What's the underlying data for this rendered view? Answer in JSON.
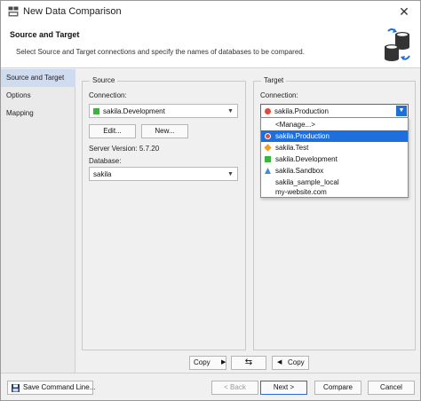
{
  "window": {
    "title": "New Data Comparison",
    "close_glyph": "✕"
  },
  "header": {
    "title": "Source and Target",
    "description": "Select Source and Target connections and specify the names of databases to be compared.",
    "icon": "database-compare-icon"
  },
  "nav": {
    "items": [
      {
        "label": "Source and Target",
        "active": true
      },
      {
        "label": "Options",
        "active": false
      },
      {
        "label": "Mapping",
        "active": false
      }
    ]
  },
  "source": {
    "legend": "Source",
    "connection_label": "Connection:",
    "connection_value": "sakila.Development",
    "connection_color": "#3cb43c",
    "edit_button": "Edit...",
    "new_button": "New...",
    "server_version": "Server Version: 5.7.20",
    "database_label": "Database:",
    "database_value": "sakila"
  },
  "target": {
    "legend": "Target",
    "connection_label": "Connection:",
    "connection_value": "sakila.Production",
    "connection_color": "#e04a3a",
    "dropdown_items": [
      {
        "label": "<Manage...>",
        "icon": "none",
        "color": ""
      },
      {
        "label": "sakila.Production",
        "icon": "circle",
        "color": "#e04a3a",
        "selected": true
      },
      {
        "label": "sakila.Test",
        "icon": "diamond",
        "color": "#f2a01c"
      },
      {
        "label": "sakila.Development",
        "icon": "square",
        "color": "#3cb43c"
      },
      {
        "label": "sakila.Sandbox",
        "icon": "triangle",
        "color": "#3a8ee0"
      },
      {
        "label": "sakila_sample_local",
        "icon": "none",
        "color": ""
      },
      {
        "label": "my-website.com",
        "icon": "none",
        "color": ""
      }
    ]
  },
  "copy_bar": {
    "copy_right": "Copy",
    "swap_glyph": "⇆",
    "copy_left": "Copy"
  },
  "footer": {
    "save_command_line": "Save Command Line...",
    "back": "< Back",
    "next": "Next >",
    "compare": "Compare",
    "cancel": "Cancel"
  },
  "colors": {
    "accent": "#1e6fdc",
    "nav_active": "#cfdcf0"
  }
}
